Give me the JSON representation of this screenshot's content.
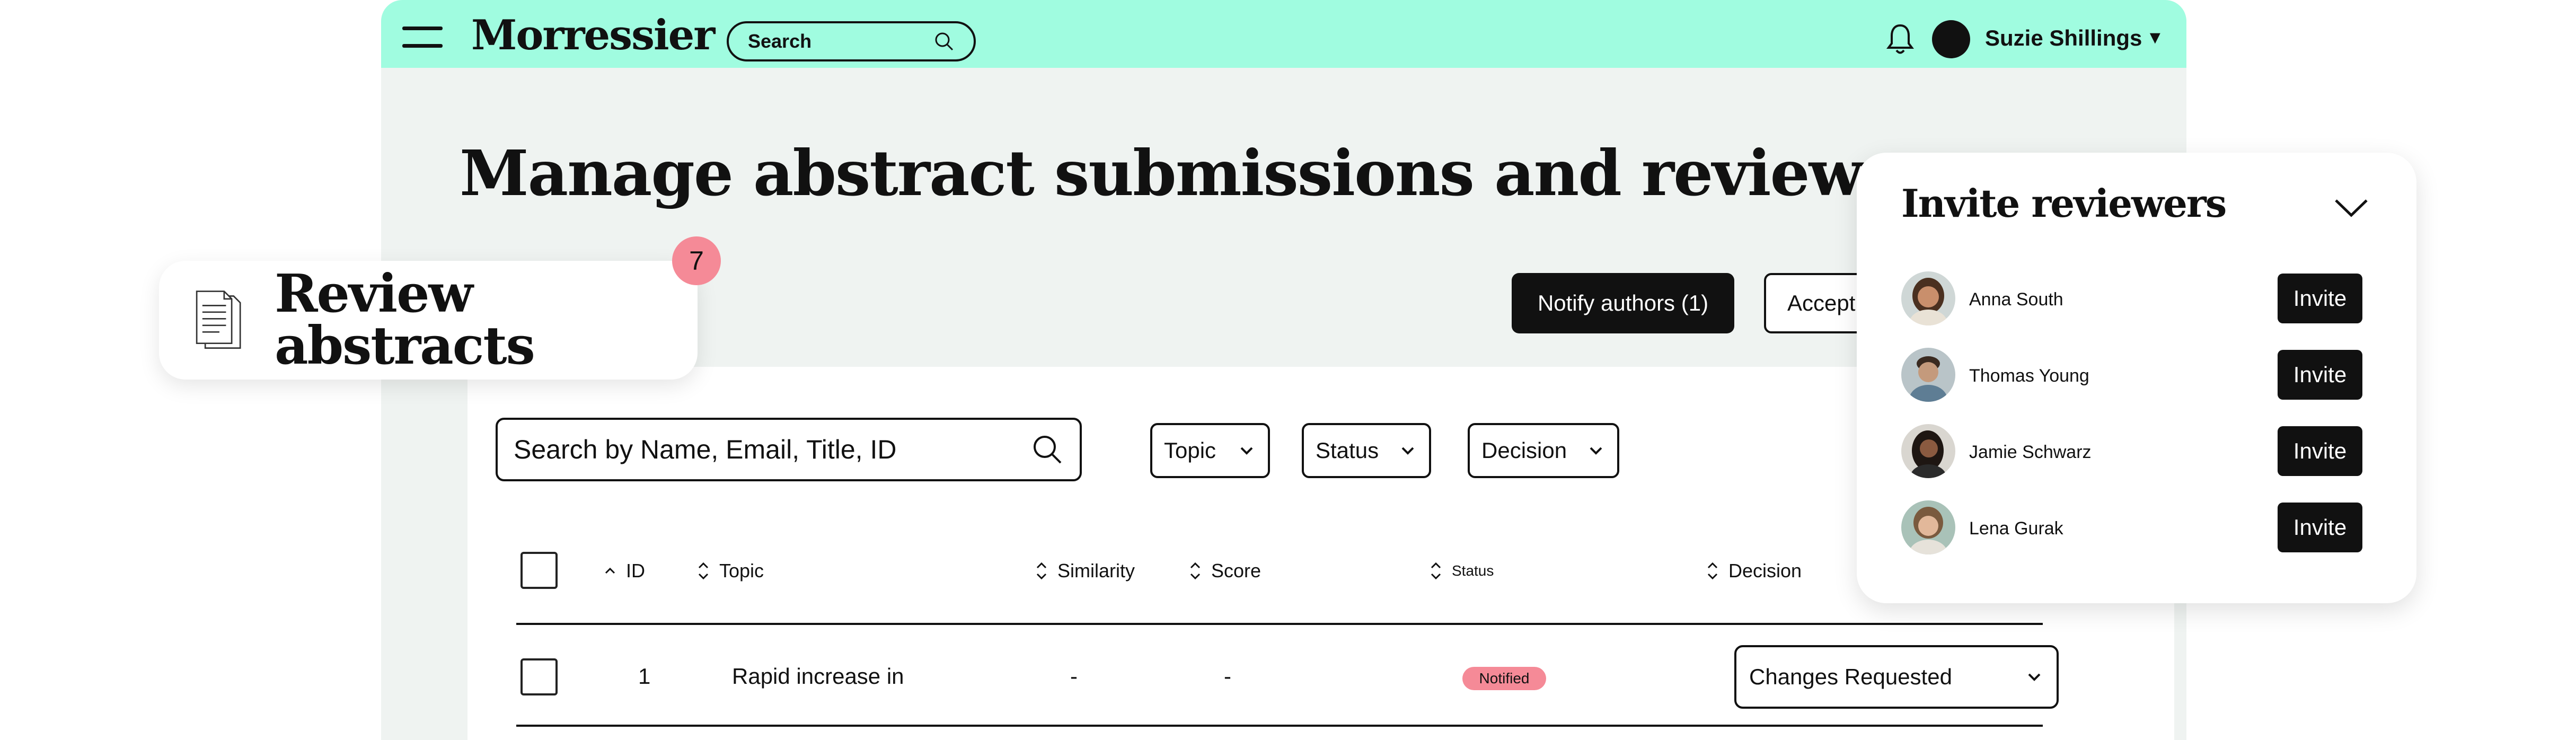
{
  "header": {
    "brand": "Morressier",
    "search_label": "Search",
    "user_name": "Suzie Shillings"
  },
  "page": {
    "title": "Manage abstract submissions and reviews",
    "notify_button": "Notify authors (1)",
    "accept_button": "Accept"
  },
  "review_card": {
    "title": "Review abstracts",
    "badge_count": "7"
  },
  "table": {
    "search_placeholder": "Search by Name, Email, Title, ID",
    "filters": [
      "Topic",
      "Status",
      "Decision"
    ],
    "columns": [
      "ID",
      "Topic",
      "Similarity",
      "Score",
      "Status",
      "Decision"
    ],
    "rows": [
      {
        "id": "1",
        "topic": "Rapid increase in",
        "similarity": "-",
        "score": "-",
        "status": "Notified",
        "decision": "Changes Requested"
      }
    ]
  },
  "invite_panel": {
    "title": "Invite reviewers",
    "button_label": "Invite",
    "reviewers": [
      {
        "name": "Anna South"
      },
      {
        "name": "Thomas Young"
      },
      {
        "name": "Jamie Schwarz"
      },
      {
        "name": "Lena Gurak"
      }
    ]
  },
  "colors": {
    "topbar": "#a0fce0",
    "page_bg": "#eff3f1",
    "badge": "#f58a97",
    "dark": "#111111"
  }
}
